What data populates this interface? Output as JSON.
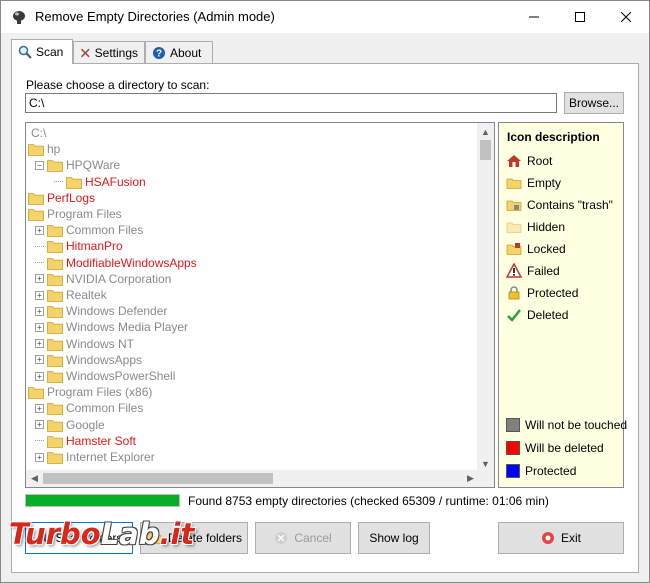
{
  "window": {
    "title": "Remove Empty Directories (Admin mode)"
  },
  "tabs": [
    {
      "label": "Scan",
      "icon": "magnifier-icon",
      "active": true
    },
    {
      "label": "Settings",
      "icon": "tools-icon",
      "active": false
    },
    {
      "label": "About",
      "icon": "help-icon",
      "active": false
    }
  ],
  "scan": {
    "choose_label": "Please choose a directory to scan:",
    "directory_value": "C:\\",
    "browse_label": "Browse..."
  },
  "tree": {
    "rows": [
      {
        "label": "C:\\",
        "indent": 0,
        "expander": "none",
        "folder": false,
        "color": "gray"
      },
      {
        "label": "hp",
        "indent": 0,
        "expander": "none",
        "folder": true,
        "color": "gray"
      },
      {
        "label": "HPQWare",
        "indent": 1,
        "expander": "minus",
        "folder": true,
        "color": "gray"
      },
      {
        "label": "HSAFusion",
        "indent": 2,
        "expander": "line",
        "folder": true,
        "color": "red"
      },
      {
        "label": "PerfLogs",
        "indent": 0,
        "expander": "none",
        "folder": true,
        "color": "red"
      },
      {
        "label": "Program Files",
        "indent": 0,
        "expander": "none",
        "folder": true,
        "color": "gray"
      },
      {
        "label": "Common Files",
        "indent": 1,
        "expander": "plus",
        "folder": true,
        "color": "gray"
      },
      {
        "label": "HitmanPro",
        "indent": 1,
        "expander": "line",
        "folder": true,
        "color": "red"
      },
      {
        "label": "ModifiableWindowsApps",
        "indent": 1,
        "expander": "line",
        "folder": true,
        "color": "red"
      },
      {
        "label": "NVIDIA Corporation",
        "indent": 1,
        "expander": "plus",
        "folder": true,
        "color": "gray"
      },
      {
        "label": "Realtek",
        "indent": 1,
        "expander": "plus",
        "folder": true,
        "color": "gray"
      },
      {
        "label": "Windows Defender",
        "indent": 1,
        "expander": "plus",
        "folder": true,
        "color": "gray"
      },
      {
        "label": "Windows Media Player",
        "indent": 1,
        "expander": "plus",
        "folder": true,
        "color": "gray"
      },
      {
        "label": "Windows NT",
        "indent": 1,
        "expander": "plus",
        "folder": true,
        "color": "gray"
      },
      {
        "label": "WindowsApps",
        "indent": 1,
        "expander": "plus",
        "folder": true,
        "color": "gray"
      },
      {
        "label": "WindowsPowerShell",
        "indent": 1,
        "expander": "plus",
        "folder": true,
        "color": "gray"
      },
      {
        "label": "Program Files (x86)",
        "indent": 0,
        "expander": "none",
        "folder": true,
        "color": "gray"
      },
      {
        "label": "Common Files",
        "indent": 1,
        "expander": "plus",
        "folder": true,
        "color": "gray"
      },
      {
        "label": "Google",
        "indent": 1,
        "expander": "plus",
        "folder": true,
        "color": "gray"
      },
      {
        "label": "Hamster Soft",
        "indent": 1,
        "expander": "line",
        "folder": true,
        "color": "red"
      },
      {
        "label": "Internet Explorer",
        "indent": 1,
        "expander": "plus",
        "folder": true,
        "color": "gray"
      }
    ]
  },
  "legend": {
    "title": "Icon description",
    "icons": [
      {
        "label": "Root",
        "icon": "root-house-icon"
      },
      {
        "label": "Empty",
        "icon": "empty-folder-icon"
      },
      {
        "label": "Contains \"trash\"",
        "icon": "trash-folder-icon"
      },
      {
        "label": "Hidden",
        "icon": "hidden-folder-icon"
      },
      {
        "label": "Locked",
        "icon": "locked-folder-icon"
      },
      {
        "label": "Failed",
        "icon": "warning-icon"
      },
      {
        "label": "Protected",
        "icon": "padlock-icon"
      },
      {
        "label": "Deleted",
        "icon": "checkmark-icon"
      }
    ],
    "colors": [
      {
        "label": "Will not be touched",
        "color": "#808080"
      },
      {
        "label": "Will be deleted",
        "color": "#ff0000"
      },
      {
        "label": "Protected",
        "color": "#0000ff"
      }
    ]
  },
  "status": {
    "progress_fraction": 1.0,
    "text": "Found 8753 empty directories (checked 65309 / runtime: 01:06 min)"
  },
  "buttons": {
    "scan_label": "Scan folders",
    "delete_label": "Delete folders",
    "cancel_label": "Cancel",
    "showlog_label": "Show log",
    "exit_label": "Exit"
  },
  "watermark": {
    "text_a": "Turbo",
    "text_b": "Lab",
    "text_c": ".it"
  },
  "colors": {
    "progress_green": "#06b025",
    "red_text": "#e11a1a",
    "legend_bg": "#ffffe1",
    "folder_yellow": "#f5d36b"
  }
}
